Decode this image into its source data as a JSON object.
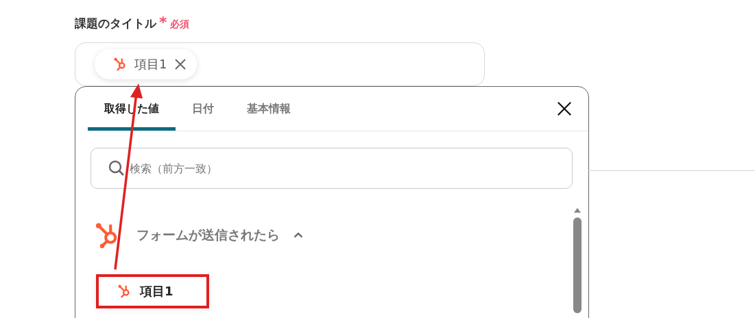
{
  "field": {
    "label": "課題のタイトル",
    "required_mark": "*",
    "required_text": "必須"
  },
  "input": {
    "chips": [
      {
        "label": "項目1"
      }
    ]
  },
  "picker": {
    "tabs": [
      {
        "label": "取得した値",
        "selected": true
      },
      {
        "label": "日付",
        "selected": false
      },
      {
        "label": "基本情報",
        "selected": false
      }
    ],
    "search": {
      "placeholder": "検索（前方一致）"
    },
    "groups": [
      {
        "title": "フォームが送信されたら",
        "expanded": true,
        "items": [
          {
            "label": "項目1",
            "highlighted": true
          }
        ]
      }
    ]
  }
}
